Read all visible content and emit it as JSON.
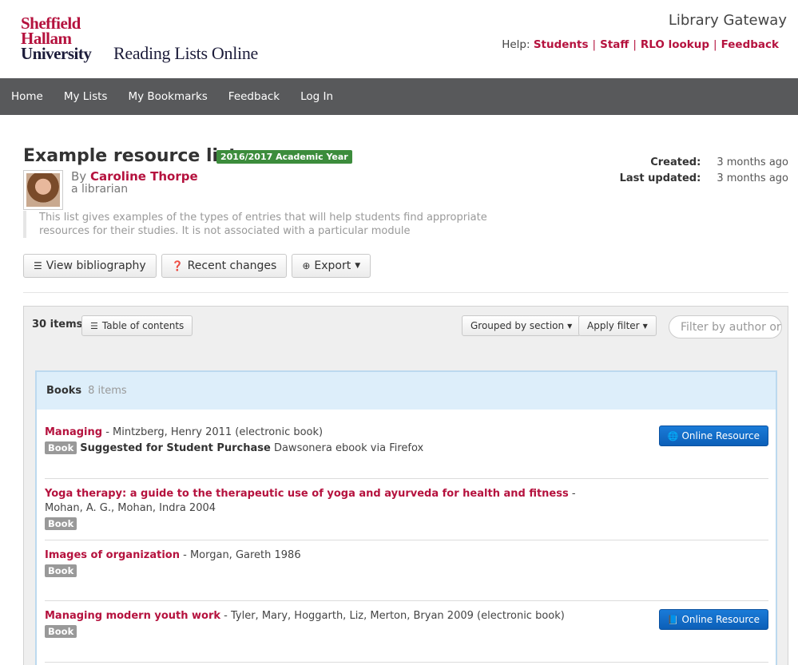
{
  "header": {
    "logo_lines": [
      "Sheffield",
      "Hallam",
      "University"
    ],
    "logo_subtitle": "Reading Lists Online",
    "gateway": "Library Gateway",
    "help_label": "Help:",
    "help_links": [
      "Students",
      "Staff",
      "RLO lookup",
      "Feedback"
    ]
  },
  "nav": {
    "items": [
      "Home",
      "My Lists",
      "My Bookmarks",
      "Feedback",
      "Log In"
    ]
  },
  "list": {
    "title": "Example resource list",
    "year_badge": "2016/2017 Academic Year",
    "by_label": "By",
    "author": "Caroline Thorpe",
    "author_role": "a librarian",
    "description": "This list gives examples of the types of entries that will help students find appropriate resources for their studies. It is not associated with a particular module",
    "created_label": "Created:",
    "created_value": "3 months ago",
    "updated_label": "Last updated:",
    "updated_value": "3 months ago"
  },
  "actions": {
    "bibliography": "View bibliography",
    "recent": "Recent changes",
    "export": "Export"
  },
  "panel": {
    "items_count": "30 items",
    "toc": "Table of contents",
    "grouped": "Grouped by section",
    "filter": "Apply filter",
    "filter_placeholder": "Filter by author or"
  },
  "section": {
    "title": "Books",
    "count": "8 items",
    "items": [
      {
        "title": "Managing",
        "rest": " - Mintzberg, Henry 2011 (electronic book)",
        "tag": "Book",
        "suggestion": "Suggested for Student Purchase",
        "note": " Dawsonera ebook via Firefox",
        "button": "Online Resource"
      },
      {
        "title": "Yoga therapy: a guide to the therapeutic use of yoga and ayurveda for health and fitness",
        "rest": " - Mohan, A. G., Mohan, Indra 2004",
        "tag": "Book"
      },
      {
        "title": "Images of organization",
        "rest": " - Morgan, Gareth 1986",
        "tag": "Book"
      },
      {
        "title": "Managing modern youth work",
        "rest": " - Tyler, Mary, Hoggarth, Liz, Merton, Bryan 2009 (electronic book)",
        "tag": "Book",
        "button": "Online Resource"
      }
    ]
  },
  "colors": {
    "brand": "#b5123e",
    "nav_bg": "#58595b",
    "badge_green": "#3c8c3c",
    "button_blue": "#0c5fb8"
  }
}
